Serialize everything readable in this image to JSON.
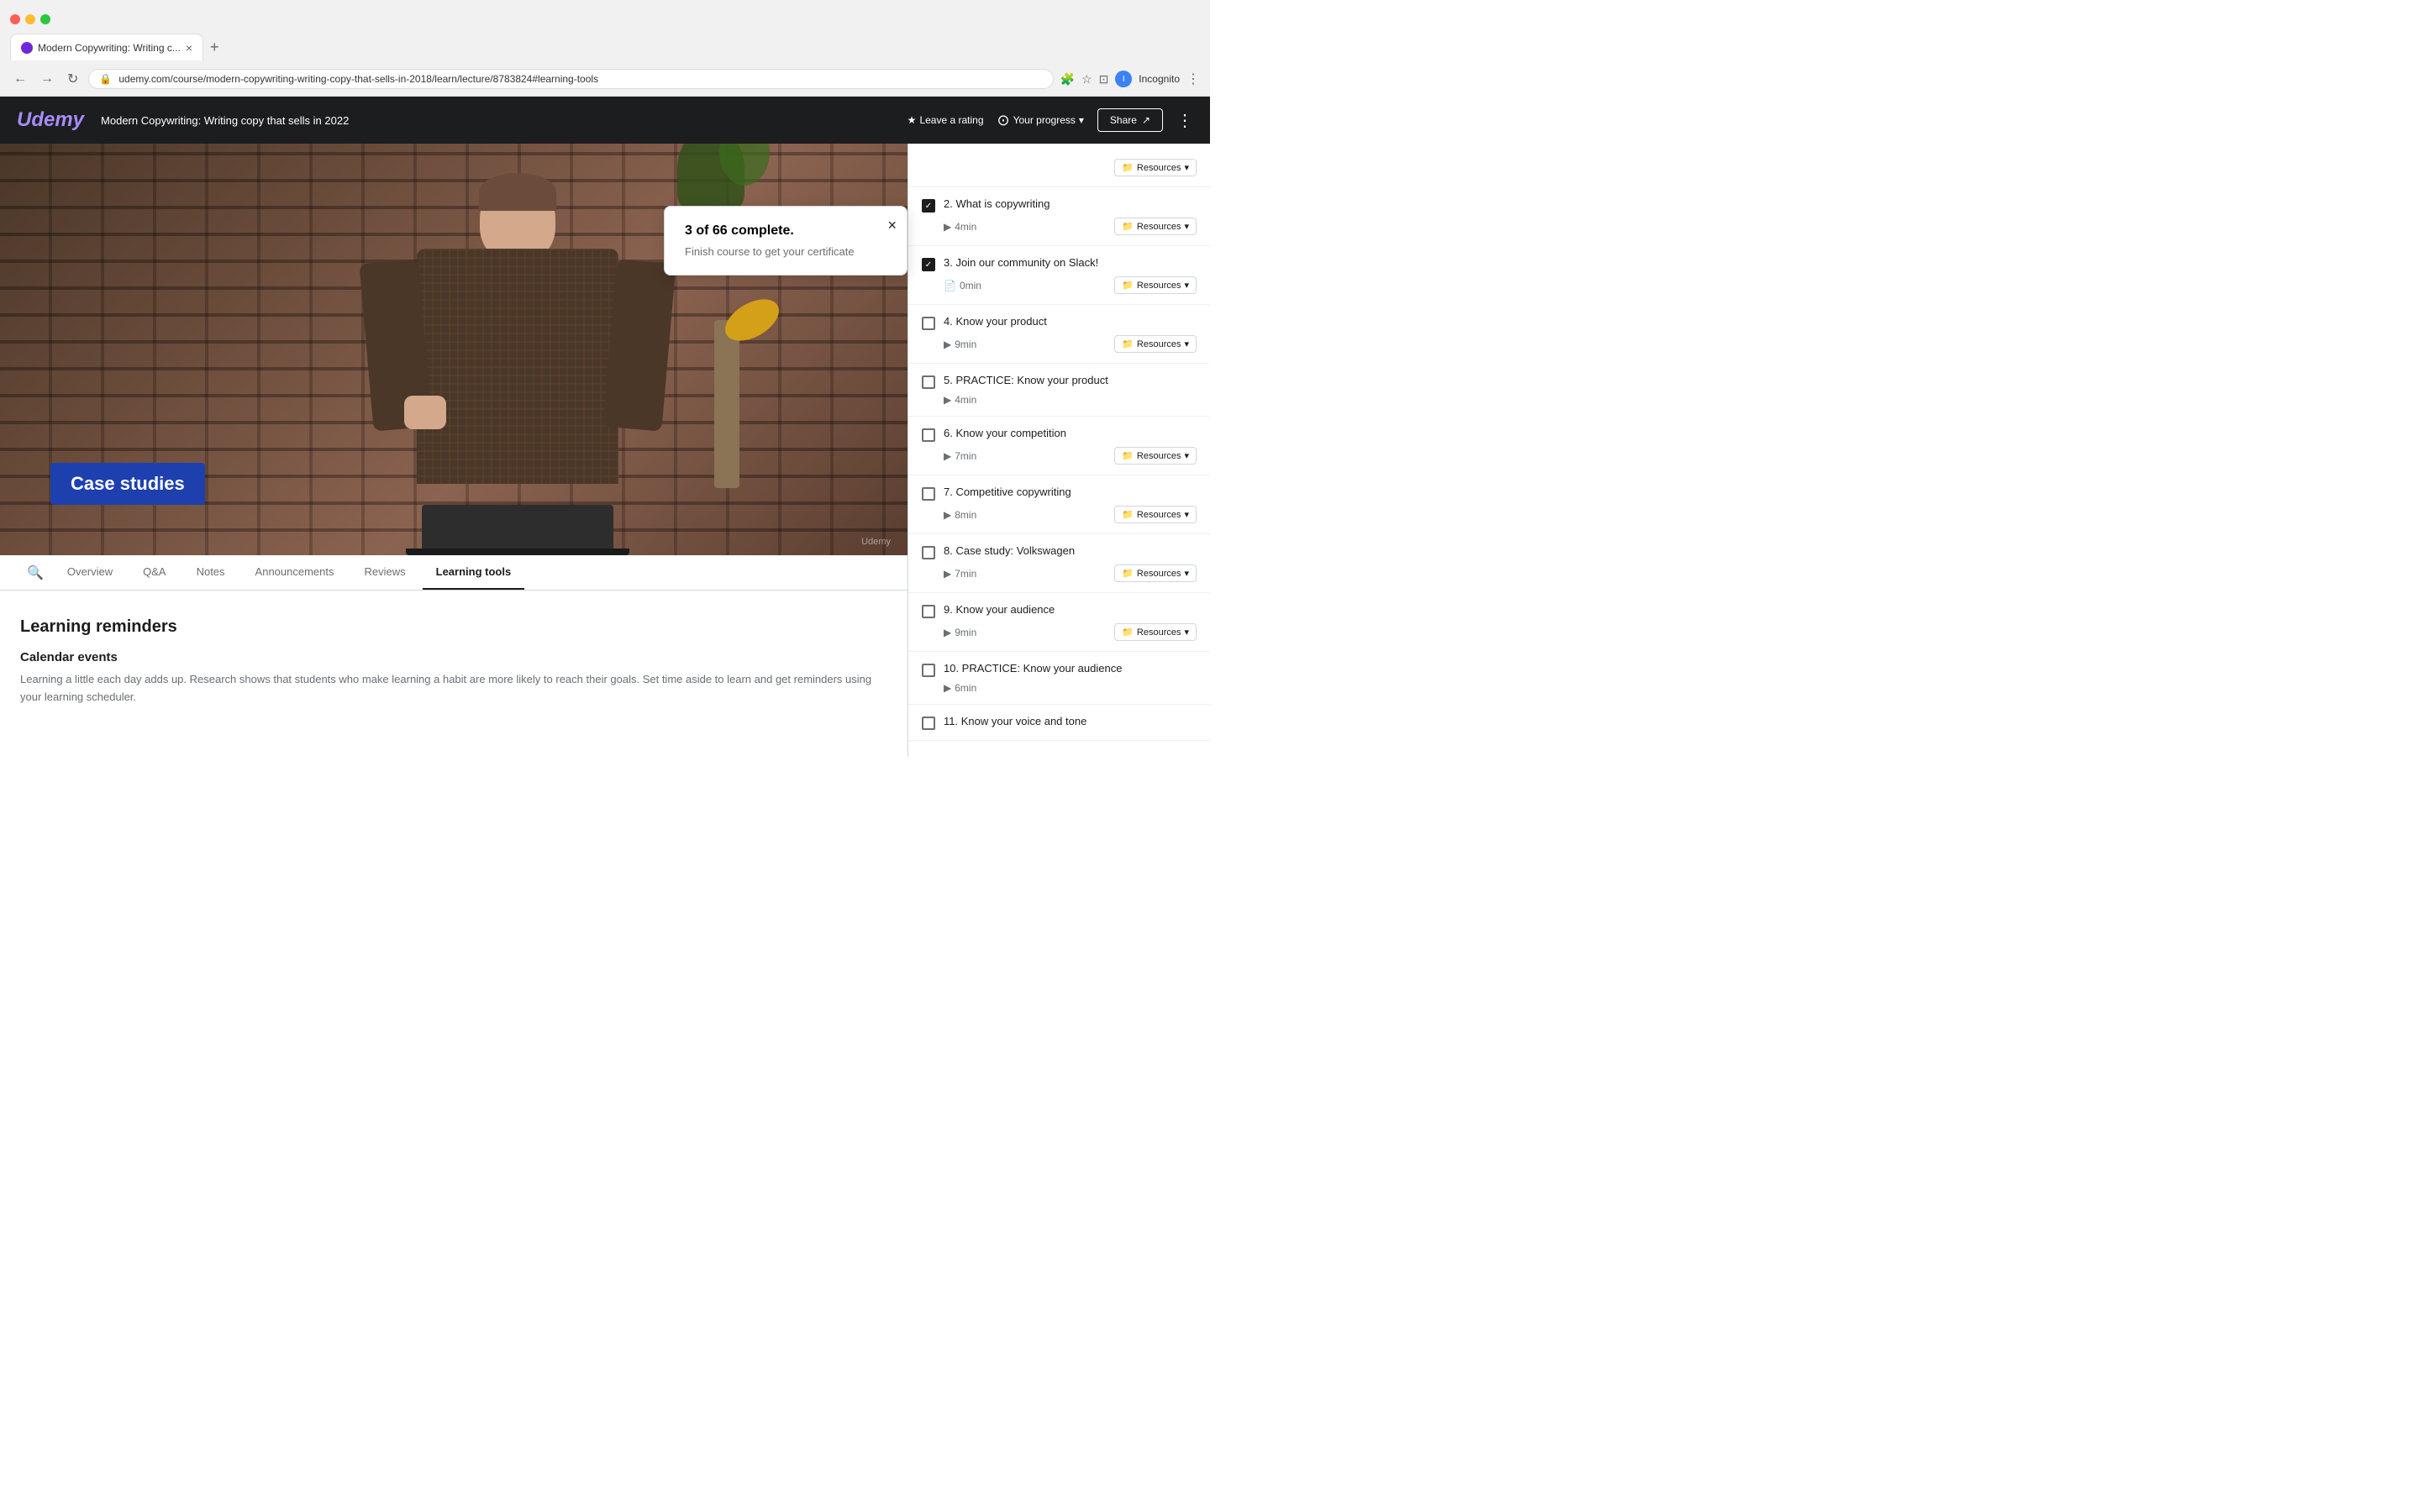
{
  "browser": {
    "tab_title": "Modern Copywriting: Writing c...",
    "url": "udemy.com/course/modern-copywriting-writing-copy-that-sells-in-2018/learn/lecture/8783824#learning-tools",
    "incognito_label": "Incognito"
  },
  "header": {
    "logo": "Udemy",
    "course_title": "Modern Copywriting: Writing copy that sells in 2022",
    "leave_rating": "Leave a rating",
    "your_progress": "Your progress",
    "share": "Share",
    "more_icon": "⋮"
  },
  "progress_popup": {
    "title": "3 of 66 complete.",
    "message": "Finish course to get your certificate",
    "close_icon": "×"
  },
  "video": {
    "badge_text": "Case studies",
    "watermark": "Udemy"
  },
  "tabs": {
    "search_icon": "🔍",
    "items": [
      {
        "label": "Overview",
        "active": false
      },
      {
        "label": "Q&A",
        "active": false
      },
      {
        "label": "Notes",
        "active": false
      },
      {
        "label": "Announcements",
        "active": false
      },
      {
        "label": "Reviews",
        "active": false
      },
      {
        "label": "Learning tools",
        "active": true
      }
    ]
  },
  "content": {
    "section1_title": "Learning reminders",
    "section2_title": "Calendar events",
    "section2_text": "Learning a little each day adds up. Research shows that students who make learning a habit are more likely to reach their goals. Set time aside to learn and get reminders using your learning scheduler."
  },
  "sidebar": {
    "items": [
      {
        "id": 2,
        "title": "2. What is copywriting",
        "checked": true,
        "duration": "4min",
        "duration_icon": "▶",
        "has_resources": true,
        "resources_label": "Resources"
      },
      {
        "id": 3,
        "title": "3. Join our community on Slack!",
        "checked": true,
        "duration": "0min",
        "duration_icon": "📄",
        "has_resources": true,
        "resources_label": "Resources"
      },
      {
        "id": 4,
        "title": "4. Know your product",
        "checked": false,
        "duration": "9min",
        "duration_icon": "▶",
        "has_resources": true,
        "resources_label": "Resources"
      },
      {
        "id": 5,
        "title": "5. PRACTICE: Know your product",
        "checked": false,
        "duration": "4min",
        "duration_icon": "▶",
        "has_resources": false,
        "resources_label": ""
      },
      {
        "id": 6,
        "title": "6. Know your competition",
        "checked": false,
        "duration": "7min",
        "duration_icon": "▶",
        "has_resources": true,
        "resources_label": "Resources"
      },
      {
        "id": 7,
        "title": "7. Competitive copywriting",
        "checked": false,
        "duration": "8min",
        "duration_icon": "▶",
        "has_resources": true,
        "resources_label": "Resources"
      },
      {
        "id": 8,
        "title": "8. Case study: Volkswagen",
        "checked": false,
        "duration": "7min",
        "duration_icon": "▶",
        "has_resources": true,
        "resources_label": "Resources"
      },
      {
        "id": 9,
        "title": "9. Know your audience",
        "checked": false,
        "duration": "9min",
        "duration_icon": "▶",
        "has_resources": true,
        "resources_label": "Resources"
      },
      {
        "id": 10,
        "title": "10. PRACTICE: Know your audience",
        "checked": false,
        "duration": "6min",
        "duration_icon": "▶",
        "has_resources": false,
        "resources_label": ""
      },
      {
        "id": 11,
        "title": "11. Know your voice and tone",
        "checked": false,
        "duration": "",
        "duration_icon": "▶",
        "has_resources": false,
        "resources_label": ""
      }
    ],
    "partial_top": {
      "has_resources": true,
      "resources_label": "Resources"
    }
  }
}
